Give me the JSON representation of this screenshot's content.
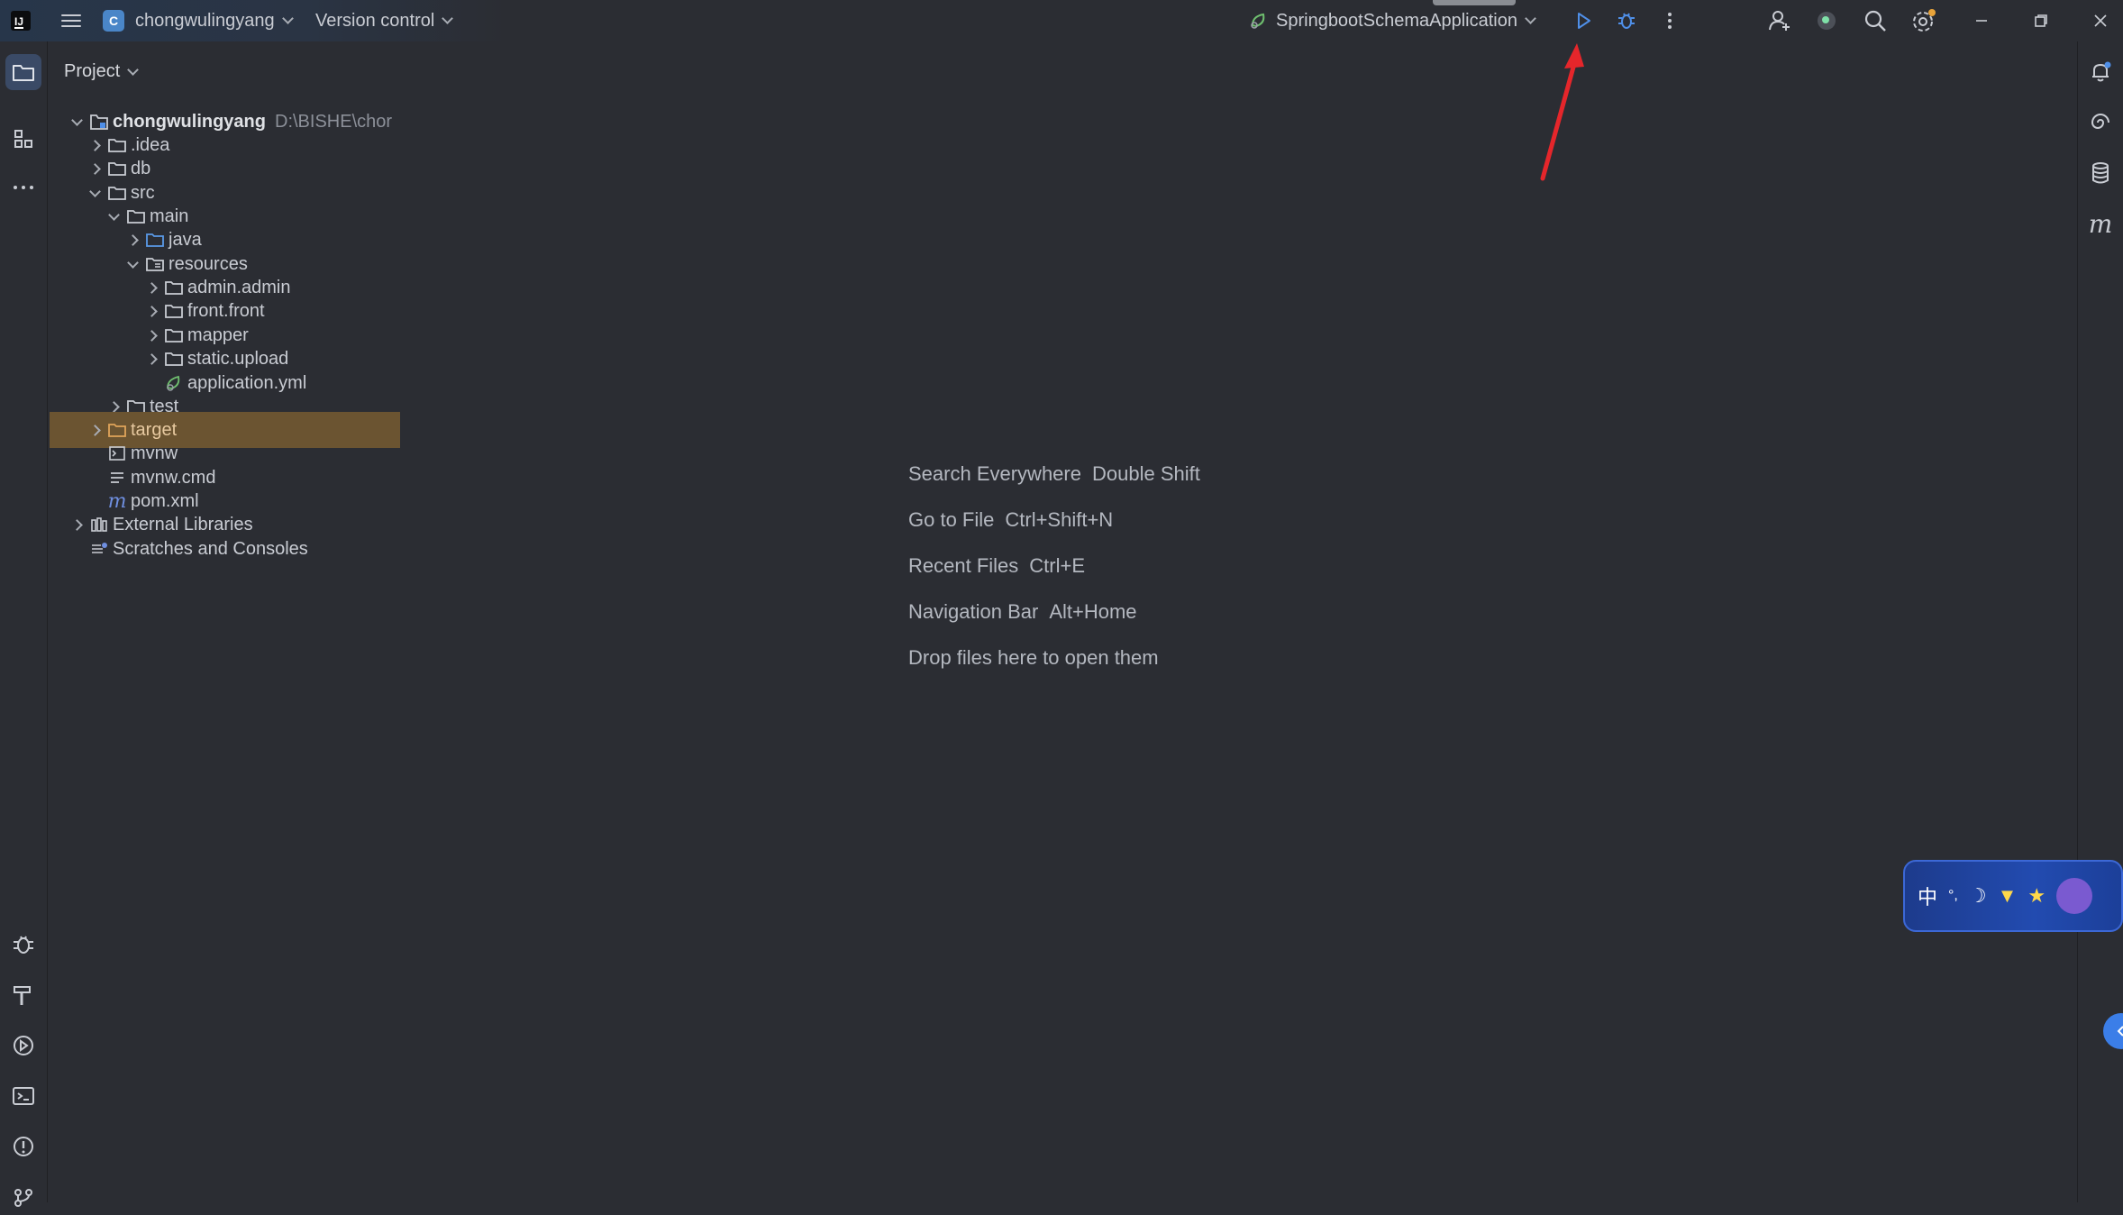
{
  "titlebar": {
    "app_logo": "IJ",
    "project_badge": "C",
    "project_name": "chongwulingyang",
    "vcs_label": "Version control",
    "run_config": "SpringbootSchemaApplication"
  },
  "panel": {
    "title": "Project"
  },
  "tree": [
    {
      "label": "chongwulingyang",
      "extra": "D:\\BISHE\\chor",
      "icon": "module-folder-icon"
    },
    {
      "label": ".idea",
      "icon": "folder-icon"
    },
    {
      "label": "db",
      "icon": "folder-icon"
    },
    {
      "label": "src",
      "icon": "folder-icon"
    },
    {
      "label": "main",
      "icon": "folder-icon"
    },
    {
      "label": "java",
      "icon": "source-folder-icon"
    },
    {
      "label": "resources",
      "icon": "resources-folder-icon"
    },
    {
      "label": "admin.admin",
      "icon": "folder-icon"
    },
    {
      "label": "front.front",
      "icon": "folder-icon"
    },
    {
      "label": "mapper",
      "icon": "folder-icon"
    },
    {
      "label": "static.upload",
      "icon": "folder-icon"
    },
    {
      "label": "application.yml",
      "icon": "spring-yml-icon"
    },
    {
      "label": "test",
      "icon": "folder-icon"
    },
    {
      "label": "target",
      "icon": "excluded-folder-icon"
    },
    {
      "label": "mvnw",
      "icon": "shell-script-icon"
    },
    {
      "label": "mvnw.cmd",
      "icon": "text-file-icon"
    },
    {
      "label": "pom.xml",
      "icon": "maven-icon"
    },
    {
      "label": "External Libraries",
      "icon": "libraries-icon"
    },
    {
      "label": "Scratches and Consoles",
      "icon": "scratches-icon"
    }
  ],
  "hints": [
    {
      "label": "Search Everywhere",
      "shortcut": "Double Shift"
    },
    {
      "label": "Go to File",
      "shortcut": "Ctrl+Shift+N"
    },
    {
      "label": "Recent Files",
      "shortcut": "Ctrl+E"
    },
    {
      "label": "Navigation Bar",
      "shortcut": "Alt+Home"
    },
    {
      "label": "Drop files here to open them",
      "shortcut": ""
    }
  ],
  "ime": {
    "lang": "中"
  },
  "colors": {
    "background": "#2b2d33",
    "selection": "#6b5431",
    "accent": "#4a86c8",
    "run_green": "#5fb35f",
    "annotation_red": "#e5262b"
  }
}
